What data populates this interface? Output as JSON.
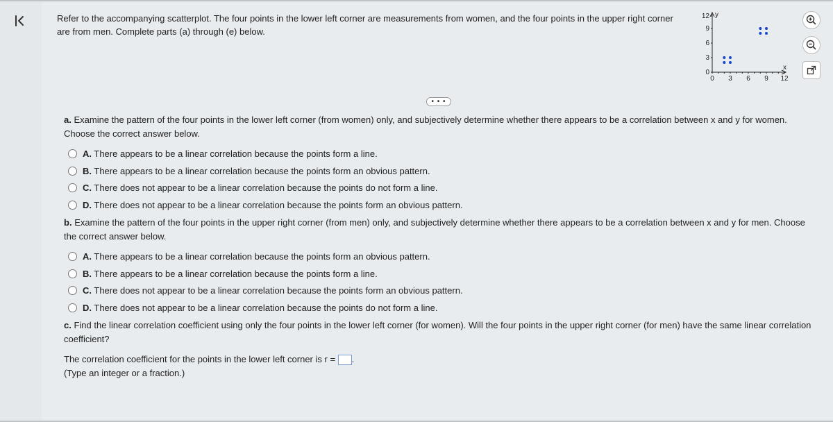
{
  "intro": "Refer to the accompanying scatterplot. The four points in the lower left corner are measurements from women, and the four points in the upper right corner are from men. Complete parts (a) through (e) below.",
  "ellipsis": "• • •",
  "partA": {
    "prompt_label": "a.",
    "prompt": "Examine the pattern of the four points in the lower left corner (from women) only, and subjectively determine whether there appears to be a correlation between x and y for women. Choose the correct answer below.",
    "choices": {
      "A": {
        "tag": "A.",
        "text": "There appears to be a linear correlation because the points form a line."
      },
      "B": {
        "tag": "B.",
        "text": "There appears to be a linear correlation because the points form an obvious pattern."
      },
      "C": {
        "tag": "C.",
        "text": "There does not appear to be a linear correlation because the points do not form a line."
      },
      "D": {
        "tag": "D.",
        "text": "There does not appear to be a linear correlation because the points form an obvious pattern."
      }
    }
  },
  "partB": {
    "prompt_label": "b.",
    "prompt": "Examine the pattern of the four points in the upper right corner (from men) only, and subjectively determine whether there appears to be a correlation between x and y for men. Choose the correct answer below.",
    "choices": {
      "A": {
        "tag": "A.",
        "text": "There appears to be a linear correlation because the points form an obvious pattern."
      },
      "B": {
        "tag": "B.",
        "text": "There appears to be a linear correlation because the points form a line."
      },
      "C": {
        "tag": "C.",
        "text": "There does not appear to be a linear correlation because the points form an obvious pattern."
      },
      "D": {
        "tag": "D.",
        "text": "There does not appear to be a linear correlation because the points do not form a line."
      }
    }
  },
  "partC": {
    "prompt_label": "c.",
    "prompt": "Find the linear correlation coefficient using only the four points in the lower left corner (for women). Will the four points in the upper right corner (for men) have the same linear correlation coefficient?",
    "answer_line_before": "The correlation coefficient for the points in the lower left corner is r =",
    "answer_line_after": ".",
    "hint": "(Type an integer or a fraction.)"
  },
  "chart_data": {
    "type": "scatter",
    "title": "",
    "xlabel": "x",
    "ylabel": "y",
    "xlim": [
      0,
      12
    ],
    "ylim": [
      0,
      12
    ],
    "xticks": [
      0,
      3,
      6,
      9,
      12
    ],
    "yticks": [
      0,
      3,
      6,
      9,
      12
    ],
    "series": [
      {
        "name": "women",
        "points": [
          [
            2,
            2
          ],
          [
            2,
            3
          ],
          [
            3,
            2
          ],
          [
            3,
            3
          ]
        ]
      },
      {
        "name": "men",
        "points": [
          [
            8,
            8
          ],
          [
            8,
            9
          ],
          [
            9,
            8
          ],
          [
            9,
            9
          ]
        ]
      }
    ]
  },
  "controls": {
    "zoom_in": "zoom-in-icon",
    "zoom_out": "zoom-out-icon",
    "popout": "popout-icon"
  }
}
